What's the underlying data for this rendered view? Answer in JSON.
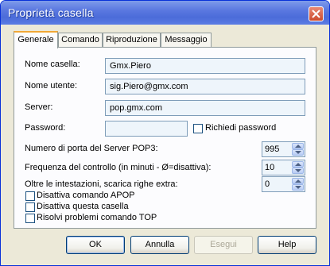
{
  "window": {
    "title": "Proprietà casella"
  },
  "tabs": [
    "Generale",
    "Comando",
    "Riproduzione",
    "Messaggio"
  ],
  "fields": {
    "account_name": {
      "label": "Nome casella:",
      "value": "Gmx.Piero"
    },
    "user_name": {
      "label": "Nome utente:",
      "value": "sig.Piero@gmx.com"
    },
    "server": {
      "label": "Server:",
      "value": "pop.gmx.com"
    },
    "password": {
      "label": "Password:",
      "value": "",
      "ask_label": "Richiedi password"
    }
  },
  "spinners": {
    "pop3_port": {
      "label": "Numero di porta del Server POP3:",
      "value": "995"
    },
    "check_frequency": {
      "label": "Frequenza del controllo (in minuti - Ø=disattiva):",
      "value": "10"
    },
    "extra_lines": {
      "label": "Oltre le intestazioni, scarica righe extra:",
      "value": "0"
    }
  },
  "options": [
    "Disattiva comando APOP",
    "Disattiva questa casella",
    "Risolvi problemi comando TOP"
  ],
  "buttons": {
    "ok": "OK",
    "cancel": "Annulla",
    "run": "Esegui",
    "help": "Help"
  },
  "icons": {
    "close": "close-icon",
    "spin_up": "arrow-up-icon",
    "spin_down": "arrow-down-icon"
  },
  "colors": {
    "titlebar": "#4b6cd9",
    "tab_highlight": "#f1a836",
    "field_bg": "#eef5fb",
    "dialog_bg": "#ece9d8"
  }
}
